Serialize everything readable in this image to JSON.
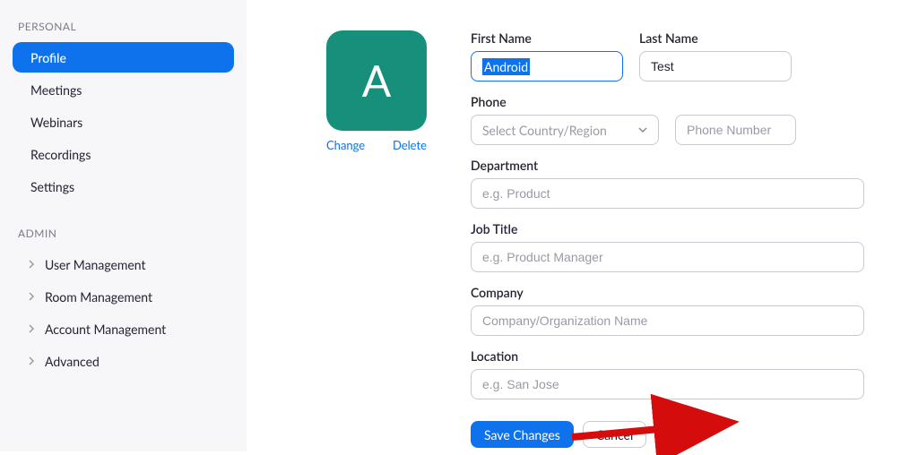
{
  "sidebar": {
    "personal": {
      "title": "PERSONAL",
      "items": [
        {
          "label": "Profile",
          "active": true
        },
        {
          "label": "Meetings"
        },
        {
          "label": "Webinars"
        },
        {
          "label": "Recordings"
        },
        {
          "label": "Settings"
        }
      ]
    },
    "admin": {
      "title": "ADMIN",
      "items": [
        {
          "label": "User Management"
        },
        {
          "label": "Room Management"
        },
        {
          "label": "Account Management"
        },
        {
          "label": "Advanced"
        }
      ]
    }
  },
  "avatar": {
    "initial": "A",
    "change": "Change",
    "delete": "Delete"
  },
  "form": {
    "first_name": {
      "label": "First Name",
      "value": "Android"
    },
    "last_name": {
      "label": "Last Name",
      "value": "Test"
    },
    "phone": {
      "label": "Phone",
      "country_placeholder": "Select Country/Region",
      "number_placeholder": "Phone Number"
    },
    "department": {
      "label": "Department",
      "placeholder": "e.g. Product"
    },
    "job_title": {
      "label": "Job Title",
      "placeholder": "e.g. Product Manager"
    },
    "company": {
      "label": "Company",
      "placeholder": "Company/Organization Name"
    },
    "location": {
      "label": "Location",
      "placeholder": "e.g. San Jose"
    }
  },
  "actions": {
    "save": "Save Changes",
    "cancel": "Cancel"
  }
}
